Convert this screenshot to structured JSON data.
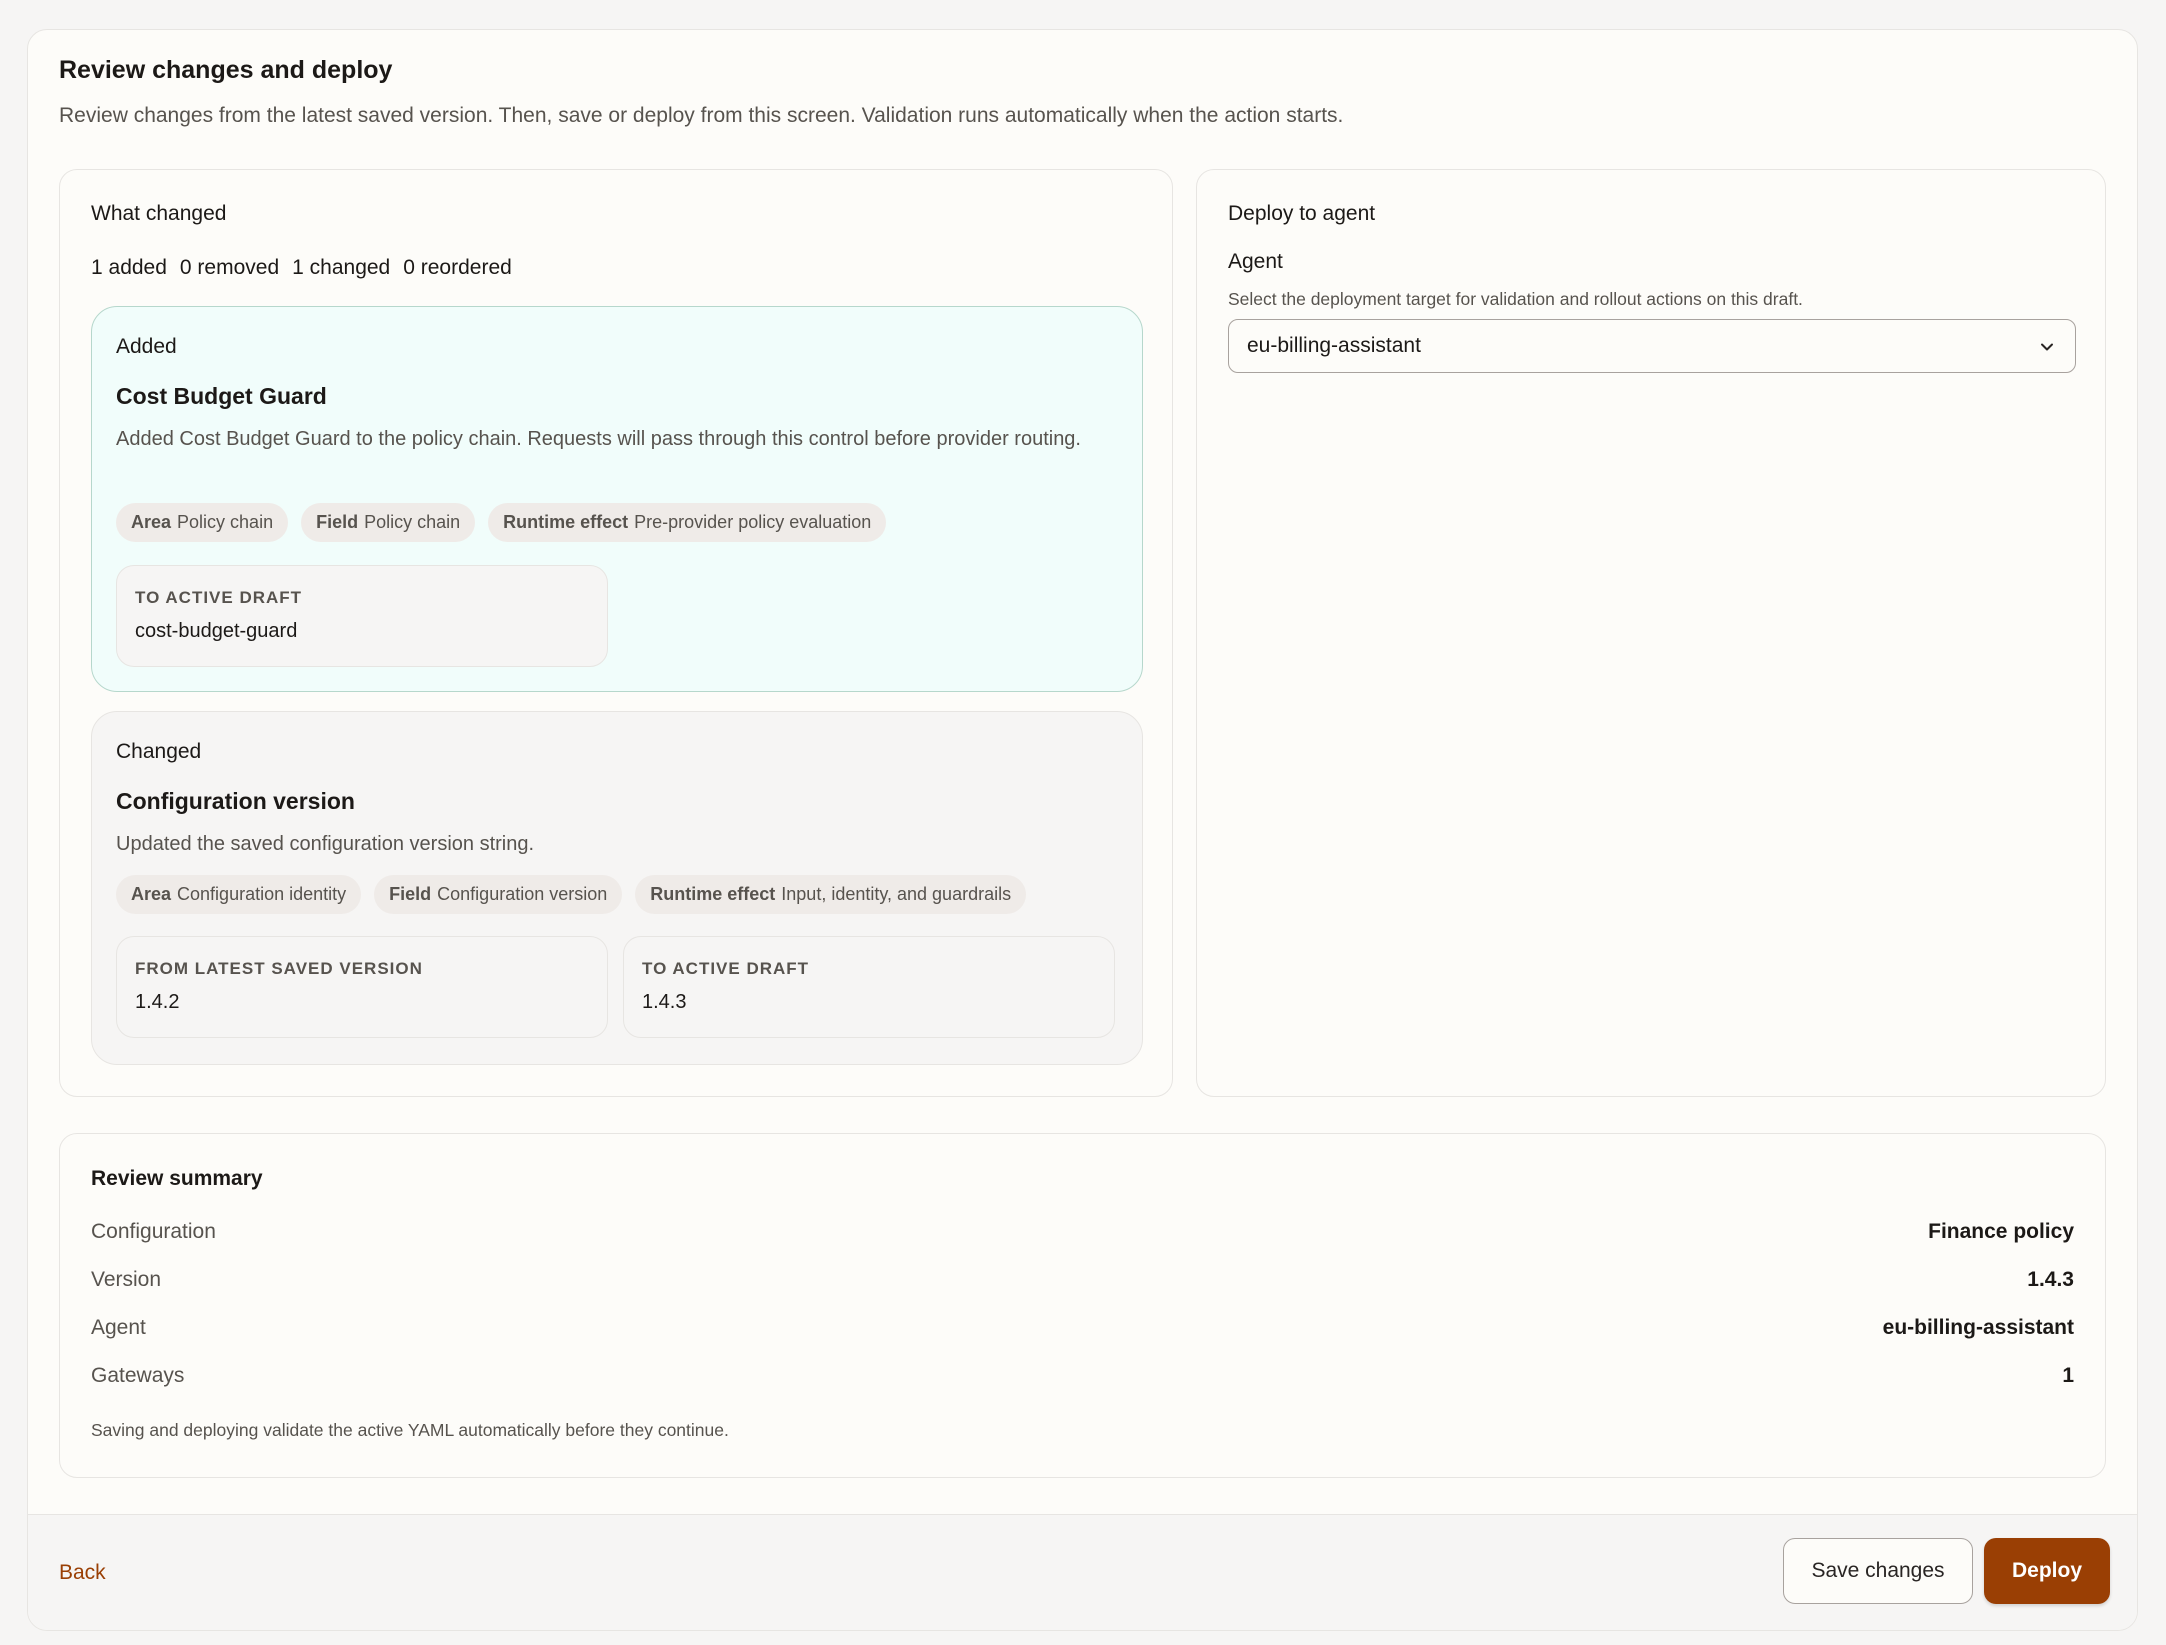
{
  "header": {
    "title": "Review changes and deploy",
    "description": "Review changes from the latest saved version. Then, save or deploy from this screen. Validation runs automatically when the action starts."
  },
  "changes": {
    "title": "What changed",
    "counts": [
      "1 added",
      "0 removed",
      "1 changed",
      "0 reordered"
    ],
    "added": {
      "label": "Added",
      "heading": "Cost Budget Guard",
      "description": "Added Cost Budget Guard to the policy chain. Requests will pass through this control before provider routing.",
      "chips": [
        {
          "key": "Area",
          "value": "Policy chain"
        },
        {
          "key": "Field",
          "value": "Policy chain"
        },
        {
          "key": "Runtime effect",
          "value": "Pre-provider policy evaluation"
        }
      ],
      "to_label": "TO ACTIVE DRAFT",
      "to_value": "cost-budget-guard"
    },
    "changed": {
      "label": "Changed",
      "heading": "Configuration version",
      "description": "Updated the saved configuration version string.",
      "chips": [
        {
          "key": "Area",
          "value": "Configuration identity"
        },
        {
          "key": "Field",
          "value": "Configuration version"
        },
        {
          "key": "Runtime effect",
          "value": "Input, identity, and guardrails"
        }
      ],
      "from_label": "FROM LATEST SAVED VERSION",
      "from_value": "1.4.2",
      "to_label": "TO ACTIVE DRAFT",
      "to_value": "1.4.3"
    }
  },
  "deploy": {
    "title": "Deploy to agent",
    "agent_label": "Agent",
    "agent_help": "Select the deployment target for validation and rollout actions on this draft.",
    "agent_selected": "eu-billing-assistant"
  },
  "summary": {
    "title": "Review summary",
    "rows": [
      {
        "key": "Configuration",
        "value": "Finance policy"
      },
      {
        "key": "Version",
        "value": "1.4.3"
      },
      {
        "key": "Agent",
        "value": "eu-billing-assistant"
      },
      {
        "key": "Gateways",
        "value": "1"
      }
    ],
    "note": "Saving and deploying validate the active YAML automatically before they continue."
  },
  "footer": {
    "back_label": "Back",
    "save_label": "Save changes",
    "deploy_label": "Deploy"
  },
  "colors": {
    "accent": "#9a3f04",
    "added_bg": "#f1fdfb",
    "added_border": "#b6d7cc"
  },
  "icons": {
    "select_chevron": "chevron-down-icon"
  }
}
